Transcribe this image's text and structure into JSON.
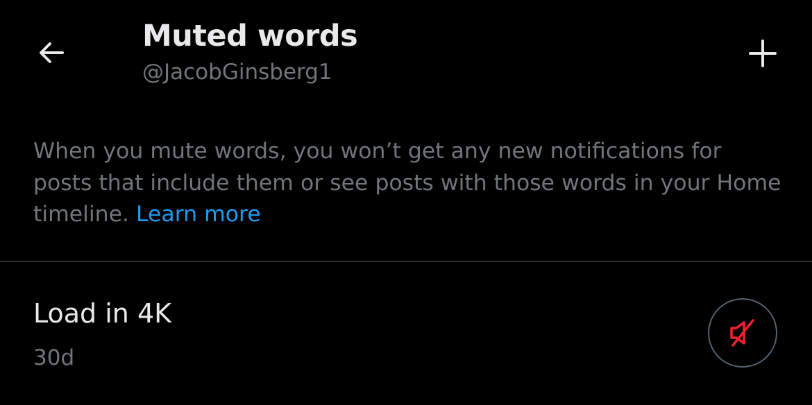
{
  "header": {
    "title": "Muted words",
    "handle": "@JacobGinsberg1",
    "back_icon": "arrow-left-icon",
    "add_icon": "plus-icon"
  },
  "description": {
    "text": "When you mute words, you won’t get any new notifications for posts that include them or see posts with those words in your Home timeline. ",
    "link_label": "Learn more"
  },
  "muted_words": [
    {
      "word": "Load in 4K",
      "duration": "30d",
      "action_icon": "muted-speaker-icon"
    }
  ],
  "colors": {
    "background": "#000000",
    "primary_text": "#e7e9ea",
    "secondary_text": "#71767b",
    "link": "#1d9bf0",
    "divider": "#2f3336",
    "mute_icon": "#f4212e",
    "button_border": "#536471"
  }
}
